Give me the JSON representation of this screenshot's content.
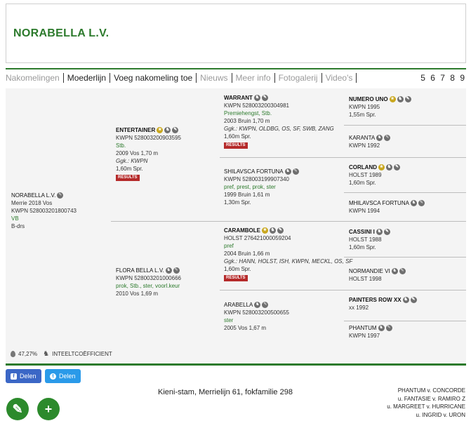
{
  "header": {
    "title": "NORABELLA L.V."
  },
  "nav": {
    "items": [
      {
        "label": "Nakomelingen",
        "dim": true
      },
      {
        "label": "Moederlijn",
        "dim": false
      },
      {
        "label": "Voeg nakomeling toe",
        "dim": false
      },
      {
        "label": "Nieuws",
        "dim": true
      },
      {
        "label": "Meer info",
        "dim": true
      },
      {
        "label": "Fotogalerij",
        "dim": true
      },
      {
        "label": "Video's",
        "dim": true
      }
    ],
    "pages": "5 6 7 8 9"
  },
  "pedigree": {
    "subject": {
      "name": "NORABELLA L.V.",
      "line1": "Merrie 2018 Vos",
      "line2": "KWPN 528003201800743",
      "line3": "VB",
      "line4": "B-drs"
    },
    "sire": {
      "name": "ENTERTAINER",
      "line1": "KWPN 528003200903595",
      "line2": "Stb.",
      "line3": "2009 Vos 1,70 m",
      "line4": "Ggk.: KWPN",
      "line5": "1,60m Spr.",
      "results": "RESULTS"
    },
    "dam": {
      "name": "FLORA BELLA L.V.",
      "line1": "KWPN 528003201000666",
      "line2": "prok, Stb., ster, voorl.keur",
      "line3": "2010 Vos 1,69 m"
    },
    "ss": {
      "name": "WARRANT",
      "line1": "KWPN 528003200304981",
      "line2": "Premiehengst, Stb.",
      "line3": "2003 Bruin 1,70 m",
      "line4": "Ggk.: KWPN, OLDBG, OS, SF, SWB, ZANG",
      "line5": "1,60m Spr.",
      "results": "RESULTS"
    },
    "sd": {
      "name": "SHILAVSCA FORTUNA",
      "line1": "KWPN 528003199907340",
      "line2": "pref, prest, prok, ster",
      "line3": "1999 Bruin 1,61 m",
      "line4": "1,30m Spr."
    },
    "ds": {
      "name": "CARAMBOLE",
      "line1": "HOLST 276421000059204",
      "line2": "pref",
      "line3": "2004 Bruin 1,66 m",
      "line4": "Ggk.: HANN, HOLST, ISH, KWPN, MECKL, OS, SF",
      "line5": "1,60m Spr.",
      "results": "RESULTS"
    },
    "dd": {
      "name": "ARABELLA",
      "line1": "KWPN 528003200500655",
      "line2": "ster",
      "line3": "2005 Vos 1,67 m"
    },
    "sss": {
      "name": "NUMERO UNO",
      "line1": "KWPN 1995",
      "line2": "1,55m Spr."
    },
    "ssd": {
      "name": "KARANTA",
      "line1": "KWPN 1992"
    },
    "sds": {
      "name": "CORLAND",
      "line1": "HOLST 1989",
      "line2": "1,60m Spr."
    },
    "sdd": {
      "name": "MHILAVSCA FORTUNA",
      "line1": "KWPN 1994"
    },
    "dss": {
      "name": "CASSINI I",
      "line1": "HOLST 1988",
      "line2": "1,60m Spr."
    },
    "dsd": {
      "name": "NORMANDIE VI",
      "line1": "HOLST 1998"
    },
    "dds": {
      "name": "PAINTERS ROW XX",
      "line1": "xx 1992"
    },
    "ddd": {
      "name": "PHANTUM",
      "line1": "KWPN 1997"
    }
  },
  "inteelt": {
    "value": "47,27%",
    "label": "INTEELTCOËFFICIENT"
  },
  "share": {
    "facebook": "Delen",
    "twitter": "Delen"
  },
  "stam": "Kieni-stam, Merrielijn 61, fokfamilie 298",
  "lineage": [
    "PHANTUM v. CONCORDE",
    "u. FANTASIE v. RAMIRO Z",
    "u. MARGREET v. HURRICANE",
    "u. INGRID v. URON"
  ],
  "icons": {
    "medal": "medal-icon",
    "group": "offspring-icon",
    "edit": "pencil-icon",
    "add": "plus-icon"
  },
  "colors": {
    "brand": "#2c7a2c",
    "results": "#b52a2a",
    "facebook": "#3b67c6",
    "twitter": "#2a9ae9"
  }
}
